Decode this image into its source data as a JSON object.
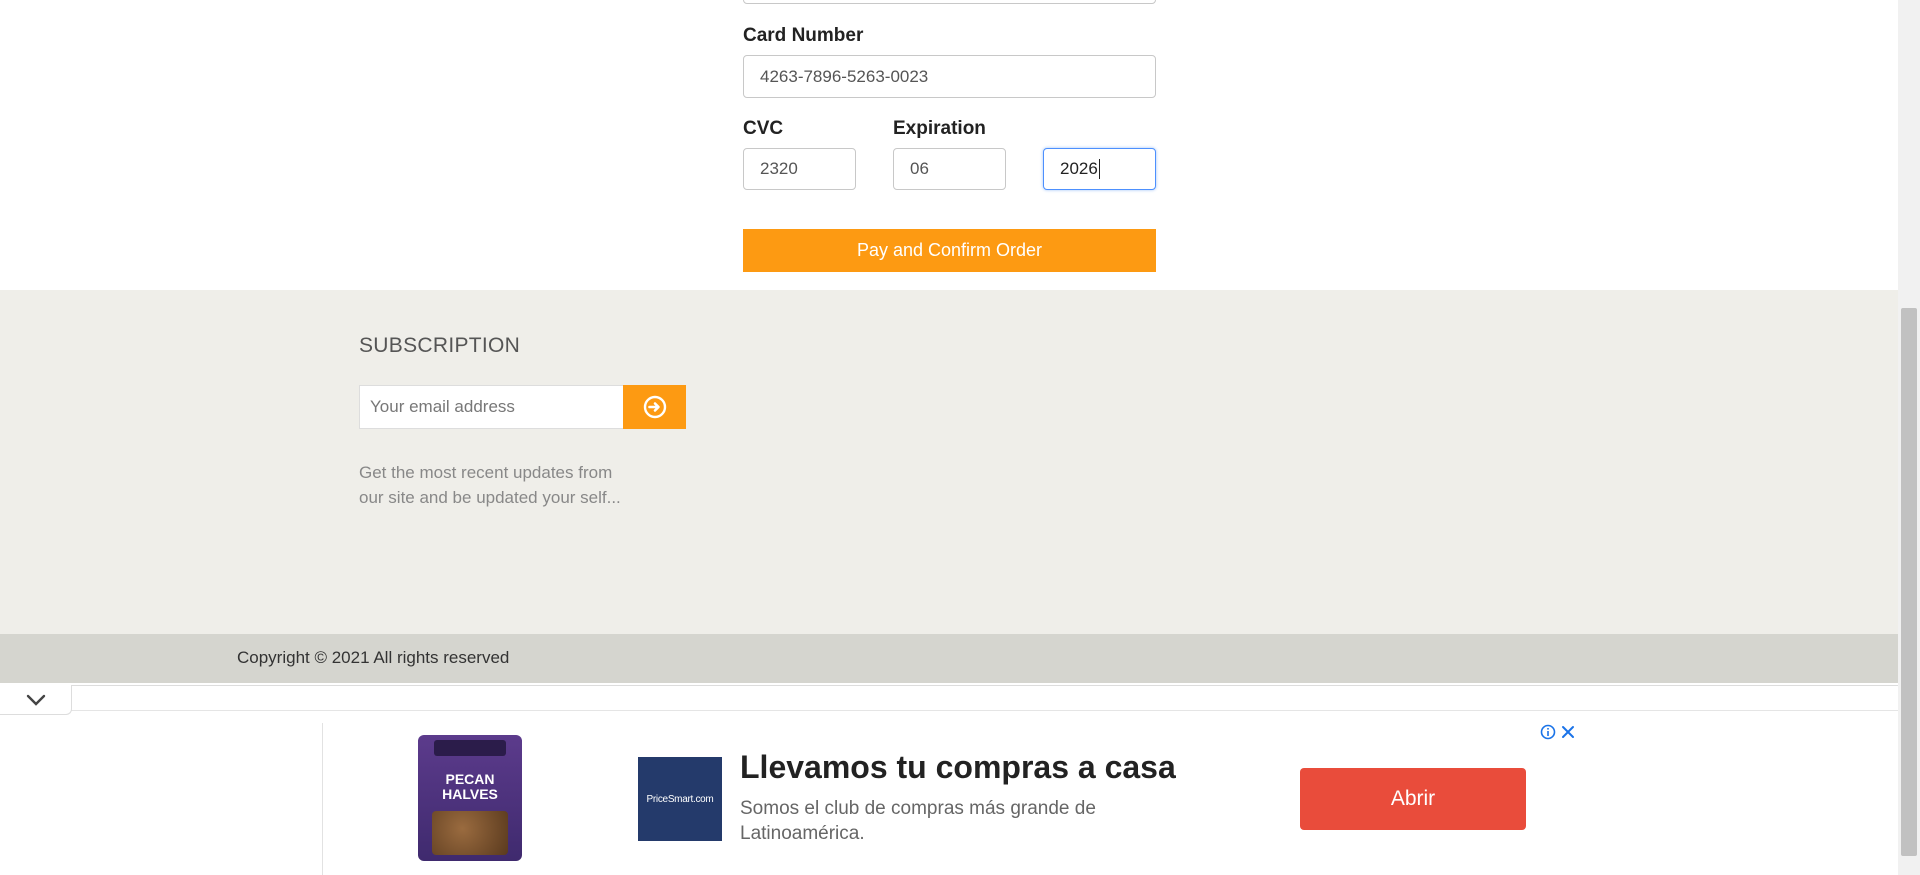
{
  "payment_form": {
    "card_number_label": "Card Number",
    "card_number_value": "4263-7896-5263-0023",
    "cvc_label": "CVC",
    "cvc_value": "2320",
    "expiration_label": "Expiration",
    "exp_month_value": "06",
    "exp_year_value": "2026",
    "pay_button_label": "Pay and Confirm Order"
  },
  "footer": {
    "subscription_title": "SUBSCRIPTION",
    "email_placeholder": "Your email address",
    "submit_icon": "arrow-circle-right-icon",
    "description_line1": "Get the most recent updates from",
    "description_line2": "our site and be updated your self...",
    "copyright": "Copyright © 2021 All rights reserved"
  },
  "ad": {
    "product_line1": "PECAN",
    "product_line2": "HALVES",
    "brand_logo_text": "PriceSmart.com",
    "headline": "Llevamos tu compras a casa",
    "subtext_line1": "Somos el club de compras más grande de",
    "subtext_line2": "Latinoamérica.",
    "button_label": "Abrir",
    "info_icon": "info-icon",
    "close_icon": "close-icon",
    "collapse_icon": "chevron-down-icon"
  },
  "colors": {
    "accent": "#fd9a12",
    "footer_bg": "#efeee9",
    "copyright_bg": "#d5d5cf",
    "ad_button": "#e94c3b",
    "ad_logo_bg": "#243a6b"
  }
}
